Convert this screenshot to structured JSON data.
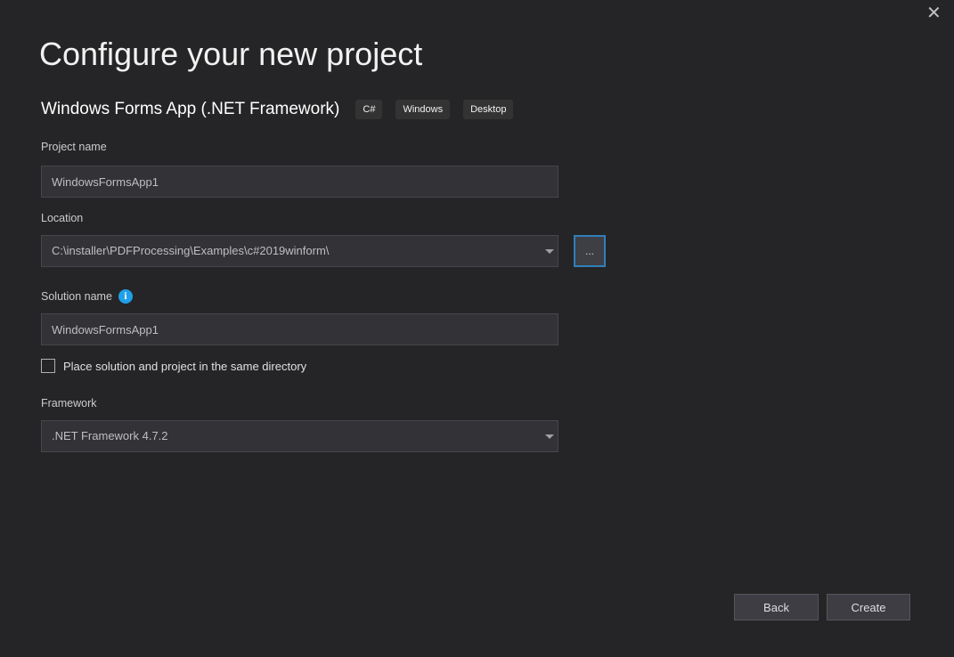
{
  "window": {
    "close_glyph": "✕"
  },
  "title": "Configure your new project",
  "template": {
    "name": "Windows Forms App (.NET Framework)",
    "tags": [
      "C#",
      "Windows",
      "Desktop"
    ]
  },
  "fields": {
    "project_name": {
      "label": "Project name",
      "value": "WindowsFormsApp1"
    },
    "location": {
      "label": "Location",
      "value": "C:\\installer\\PDFProcessing\\Examples\\c#2019winform\\",
      "browse_label": "..."
    },
    "solution_name": {
      "label": "Solution name",
      "value": "WindowsFormsApp1",
      "info_glyph": "i"
    },
    "same_directory": {
      "label": "Place solution and project in the same directory",
      "checked": false
    },
    "framework": {
      "label": "Framework",
      "value": ".NET Framework 4.7.2"
    }
  },
  "buttons": {
    "back": "Back",
    "create": "Create"
  },
  "colors": {
    "background": "#252527",
    "field_background": "#333237",
    "field_border": "#46464c",
    "focus_border": "#2f80b9",
    "info_blue": "#1fa0e9",
    "button_background": "#3e3d44"
  }
}
